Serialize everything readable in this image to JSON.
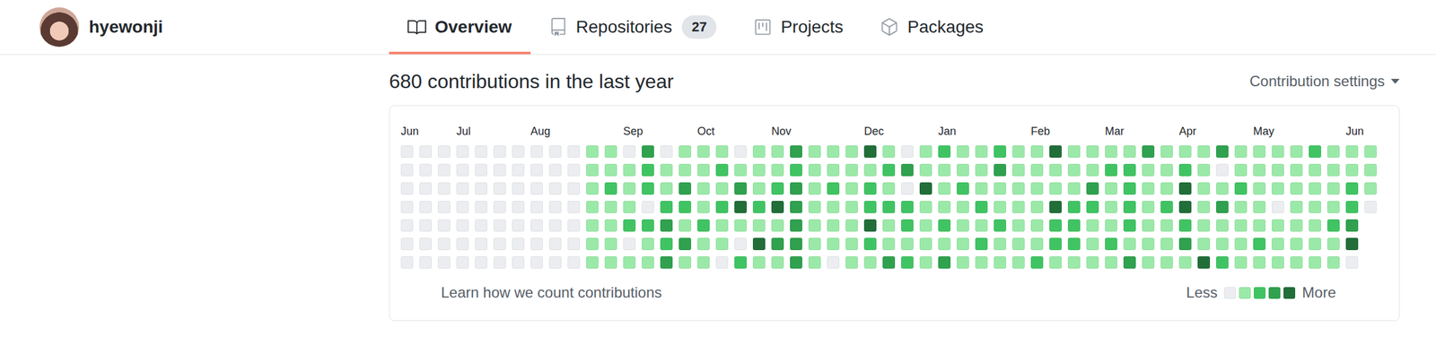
{
  "user": {
    "name": "hyewonji"
  },
  "tabs": [
    {
      "label": "Overview",
      "icon": "book",
      "selected": true
    },
    {
      "label": "Repositories",
      "icon": "repo",
      "count": "27",
      "selected": false
    },
    {
      "label": "Projects",
      "icon": "project",
      "selected": false
    },
    {
      "label": "Packages",
      "icon": "package",
      "selected": false
    }
  ],
  "contributions": {
    "title": "680 contributions in the last year",
    "settings": "Contribution settings",
    "months": [
      {
        "label": "Jun",
        "weeks": 3
      },
      {
        "label": "Jul",
        "weeks": 4
      },
      {
        "label": "Aug",
        "weeks": 5
      },
      {
        "label": "Sep",
        "weeks": 4
      },
      {
        "label": "Oct",
        "weeks": 4
      },
      {
        "label": "Nov",
        "weeks": 5
      },
      {
        "label": "Dec",
        "weeks": 4
      },
      {
        "label": "Jan",
        "weeks": 5
      },
      {
        "label": "Feb",
        "weeks": 4
      },
      {
        "label": "Mar",
        "weeks": 4
      },
      {
        "label": "Apr",
        "weeks": 4
      },
      {
        "label": "May",
        "weeks": 5
      },
      {
        "label": "Jun",
        "weeks": 2
      }
    ],
    "weeks": [
      [
        0,
        0,
        0,
        0,
        0,
        0,
        0
      ],
      [
        0,
        0,
        0,
        0,
        0,
        0,
        0
      ],
      [
        0,
        0,
        0,
        0,
        0,
        0,
        0
      ],
      [
        0,
        0,
        0,
        0,
        0,
        0,
        0
      ],
      [
        0,
        0,
        0,
        0,
        0,
        0,
        0
      ],
      [
        0,
        0,
        0,
        0,
        0,
        0,
        0
      ],
      [
        0,
        0,
        0,
        0,
        0,
        0,
        0
      ],
      [
        0,
        0,
        0,
        0,
        0,
        0,
        0
      ],
      [
        0,
        0,
        0,
        0,
        0,
        0,
        0
      ],
      [
        0,
        0,
        0,
        0,
        0,
        0,
        0
      ],
      [
        1,
        1,
        1,
        1,
        1,
        1,
        1
      ],
      [
        1,
        1,
        2,
        1,
        1,
        1,
        1
      ],
      [
        0,
        1,
        1,
        1,
        2,
        0,
        1
      ],
      [
        3,
        2,
        2,
        0,
        2,
        1,
        1
      ],
      [
        0,
        1,
        1,
        2,
        3,
        2,
        3
      ],
      [
        1,
        1,
        3,
        2,
        1,
        3,
        1
      ],
      [
        1,
        1,
        1,
        1,
        2,
        1,
        1
      ],
      [
        1,
        2,
        1,
        2,
        1,
        1,
        0
      ],
      [
        0,
        1,
        3,
        4,
        1,
        0,
        2
      ],
      [
        1,
        1,
        1,
        2,
        1,
        4,
        1
      ],
      [
        1,
        1,
        2,
        4,
        1,
        3,
        1
      ],
      [
        3,
        2,
        3,
        3,
        3,
        3,
        3
      ],
      [
        1,
        1,
        1,
        1,
        1,
        1,
        1
      ],
      [
        1,
        1,
        2,
        1,
        1,
        1,
        0
      ],
      [
        1,
        1,
        1,
        1,
        1,
        1,
        1
      ],
      [
        4,
        1,
        2,
        2,
        4,
        2,
        1
      ],
      [
        1,
        2,
        1,
        2,
        1,
        1,
        3
      ],
      [
        0,
        3,
        0,
        2,
        2,
        1,
        2
      ],
      [
        1,
        1,
        4,
        1,
        1,
        1,
        1
      ],
      [
        2,
        1,
        1,
        1,
        2,
        1,
        3
      ],
      [
        1,
        1,
        2,
        1,
        1,
        1,
        1
      ],
      [
        1,
        1,
        1,
        2,
        1,
        2,
        1
      ],
      [
        2,
        3,
        1,
        1,
        2,
        1,
        1
      ],
      [
        1,
        1,
        1,
        1,
        1,
        1,
        1
      ],
      [
        1,
        1,
        1,
        1,
        1,
        1,
        2
      ],
      [
        4,
        1,
        1,
        4,
        2,
        2,
        1
      ],
      [
        1,
        1,
        1,
        2,
        2,
        2,
        1
      ],
      [
        1,
        1,
        3,
        2,
        1,
        1,
        1
      ],
      [
        1,
        2,
        1,
        1,
        1,
        2,
        1
      ],
      [
        1,
        2,
        2,
        2,
        2,
        1,
        3
      ],
      [
        3,
        1,
        1,
        1,
        1,
        1,
        1
      ],
      [
        1,
        1,
        1,
        2,
        1,
        1,
        1
      ],
      [
        1,
        2,
        4,
        4,
        2,
        3,
        1
      ],
      [
        1,
        1,
        1,
        1,
        1,
        1,
        4
      ],
      [
        3,
        0,
        1,
        3,
        1,
        1,
        2
      ],
      [
        1,
        1,
        2,
        1,
        1,
        1,
        1
      ],
      [
        1,
        1,
        1,
        1,
        1,
        2,
        1
      ],
      [
        1,
        1,
        1,
        0,
        1,
        1,
        1
      ],
      [
        1,
        1,
        1,
        1,
        1,
        1,
        1
      ],
      [
        2,
        1,
        1,
        1,
        1,
        1,
        1
      ],
      [
        1,
        1,
        1,
        1,
        2,
        1,
        1
      ],
      [
        1,
        1,
        2,
        2,
        3,
        4,
        0
      ],
      [
        1,
        1,
        1,
        0
      ]
    ],
    "footer": {
      "link": "Learn how we count contributions",
      "less": "Less",
      "more": "More",
      "levels": [
        {
          "level": 0,
          "color": "#ebedf0"
        },
        {
          "level": 1,
          "color": "#9be9a8"
        },
        {
          "level": 2,
          "color": "#40c463"
        },
        {
          "level": 3,
          "color": "#30a14e"
        },
        {
          "level": 4,
          "color": "#216e39"
        }
      ]
    }
  }
}
